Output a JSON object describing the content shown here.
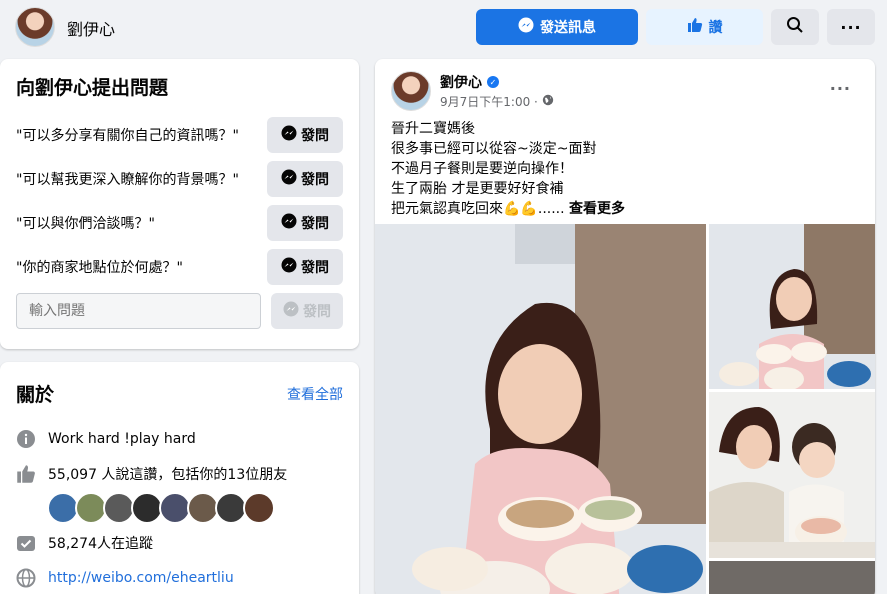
{
  "header": {
    "page_name": "劉伊心",
    "message_button": "發送訊息",
    "like_button": "讚"
  },
  "ask": {
    "title": "向劉伊心提出問題",
    "questions": [
      "\"可以多分享有關你自己的資訊嗎？\"",
      "\"可以幫我更深入瞭解你的背景嗎？\"",
      "\"可以與你們洽談嗎？\"",
      "\"你的商家地點位於何處？\""
    ],
    "send_label": "發問",
    "input_placeholder": "輸入問題"
  },
  "about": {
    "title": "關於",
    "see_all": "查看全部",
    "bio": "Work hard !play hard",
    "likes": "55,097 人說這讚，包括你的13位朋友",
    "followers": "58,274人在追蹤",
    "website": "http://weibo.com/eheartliu"
  },
  "post": {
    "author": "劉伊心",
    "time": "9月7日下午1:00 · ",
    "lines": [
      "晉升二寶媽後",
      "很多事已經可以從容~淡定~面對",
      "不過月子餐則是要逆向操作！",
      "生了兩胎 才是更要好好食補",
      "把元氣認真吃回來💪💪...... "
    ],
    "see_more": "查看更多"
  },
  "colors": {
    "primary": "#1b74e4",
    "light_primary": "#e7f3ff",
    "background": "#f0f2f5",
    "link": "#216fdb"
  },
  "icons": [
    "messenger-icon",
    "thumbs-up-icon",
    "search-icon",
    "more-icon",
    "info-icon",
    "check-icon",
    "globe-icon",
    "globe-small-icon",
    "verified-icon"
  ]
}
